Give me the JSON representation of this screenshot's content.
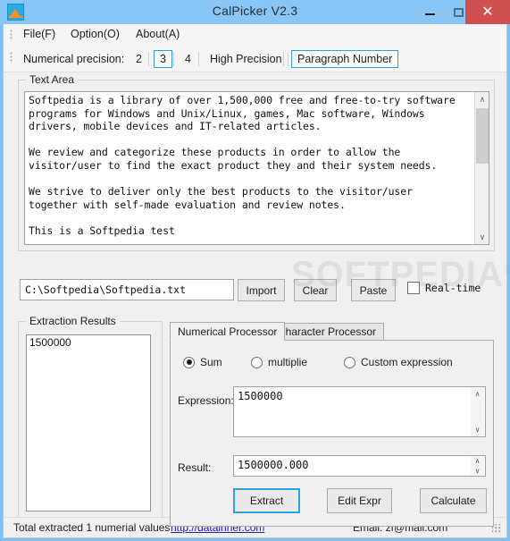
{
  "window": {
    "title": "CalPicker  V2.3",
    "icon": "app-icon",
    "controls": {
      "minimize": "–",
      "maximize": "□",
      "close": "✕"
    },
    "titlebar_color": "#87c6f7",
    "close_color": "#d05050",
    "accent_color": "#2f9fe0"
  },
  "menubar": {
    "items": [
      {
        "label": "File(F)"
      },
      {
        "label": "Option(O)"
      },
      {
        "label": "About(A)"
      }
    ]
  },
  "toolbar": {
    "precision_label": "Numerical precision:",
    "options": [
      {
        "label": "2",
        "selected": false
      },
      {
        "label": "3",
        "selected": true
      },
      {
        "label": "4",
        "selected": false
      }
    ],
    "high_precision_label": "High Precision",
    "paragraph_number_label": "Paragraph Number"
  },
  "text_area": {
    "group_title": "Text Area",
    "content": "Softpedia is a library of over 1,500,000 free and free-to-try software\nprograms for Windows and Unix/Linux, games, Mac software, Windows\ndrivers, mobile devices and IT-related articles.\n\nWe review and categorize these products in order to allow the\nvisitor/user to find the exact product they and their system needs.\n\nWe strive to deliver only the best products to the visitor/user\ntogether with self-made evaluation and review notes.\n\nThis is a Softpedia test\n\nhttp://win.softpedia.com",
    "scroll_up_glyph": "∧",
    "scroll_down_glyph": "∨"
  },
  "file_row": {
    "path_value": "C:\\Softpedia\\Softpedia.txt",
    "import_label": "Import",
    "clear_label": "Clear",
    "paste_label": "Paste",
    "realtime_label": "Real-time",
    "realtime_checked": false
  },
  "extraction": {
    "group_title": "Extraction Results",
    "items": [
      "1500000"
    ]
  },
  "tabs": [
    {
      "label": "Numerical Processor",
      "active": true
    },
    {
      "label": "Character Processor",
      "active": false
    }
  ],
  "numerical_processor": {
    "modes": [
      {
        "label": "Sum",
        "selected": true
      },
      {
        "label": "multiplie",
        "selected": false
      },
      {
        "label": "Custom expression",
        "selected": false
      }
    ],
    "expression_label": "Expression:",
    "expression_value": "1500000",
    "result_label": "Result:",
    "result_value": "1500000.000",
    "extract_label": "Extract",
    "edit_expr_label": "Edit Expr",
    "calculate_label": "Calculate",
    "spinner_up": "∧",
    "spinner_down": "∨"
  },
  "statusbar": {
    "total_text": "Total extracted 1 numerial values",
    "link_text": "http://datainner.com",
    "email_text": "Email: zf@mail.com"
  },
  "watermark": {
    "text": "SOFTPEDIA",
    "mark": "®"
  }
}
